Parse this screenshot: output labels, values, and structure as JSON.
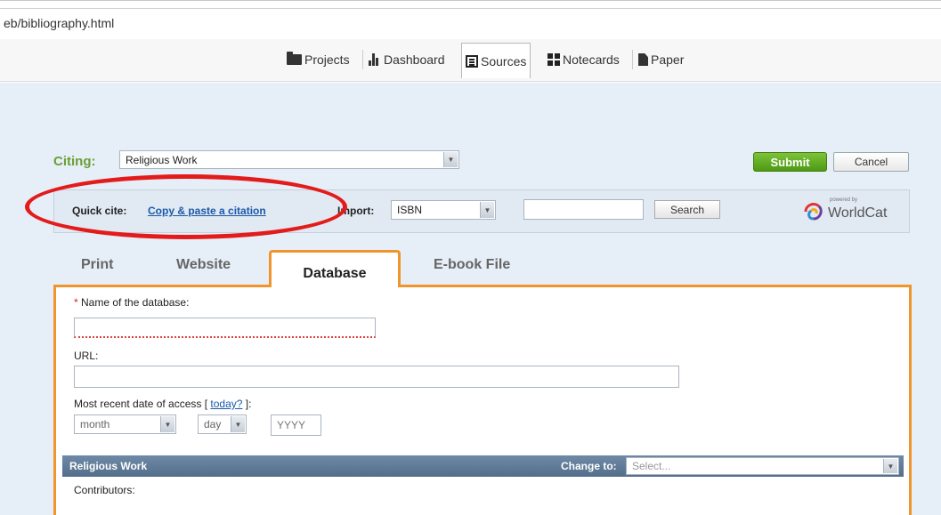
{
  "browser": {
    "url": "eb/bibliography.html"
  },
  "nav": {
    "items": [
      {
        "label": "Projects"
      },
      {
        "label": "Dashboard"
      },
      {
        "label": "Sources"
      },
      {
        "label": "Notecards"
      },
      {
        "label": "Paper"
      }
    ],
    "active": "Sources"
  },
  "citing": {
    "label": "Citing:",
    "selected": "Religious Work",
    "submit_label": "Submit",
    "cancel_label": "Cancel"
  },
  "quickbar": {
    "quick_cite_label": "Quick cite:",
    "quick_cite_link": "Copy & paste a citation",
    "import_label": "Import:",
    "import_selected": "ISBN",
    "search_value": "",
    "search_label": "Search",
    "powered_by": "powered by",
    "worldcat": "WorldCat"
  },
  "tabs": [
    {
      "label": "Print"
    },
    {
      "label": "Website"
    },
    {
      "label": "Database"
    },
    {
      "label": "E-book File"
    }
  ],
  "active_tab": "Database",
  "form": {
    "db_name_label": "Name of the database:",
    "db_name_required": "*",
    "db_name_value": "",
    "url_label": "URL:",
    "url_value": "",
    "access_label_prefix": "Most recent date of access [ ",
    "access_today_link": "today?",
    "access_label_suffix": " ]:",
    "month_value": "month",
    "day_value": "day",
    "year_placeholder": "YYYY",
    "section_title": "Religious Work",
    "change_to_label": "Change to:",
    "change_to_value": "Select...",
    "contributors_label": "Contributors:"
  },
  "colors": {
    "accent_green": "#6aa036",
    "tab_orange": "#f0952b",
    "link_blue": "#1a5aa8",
    "annotation_red": "#e31b1b",
    "section_bar": "#5f7b98"
  }
}
